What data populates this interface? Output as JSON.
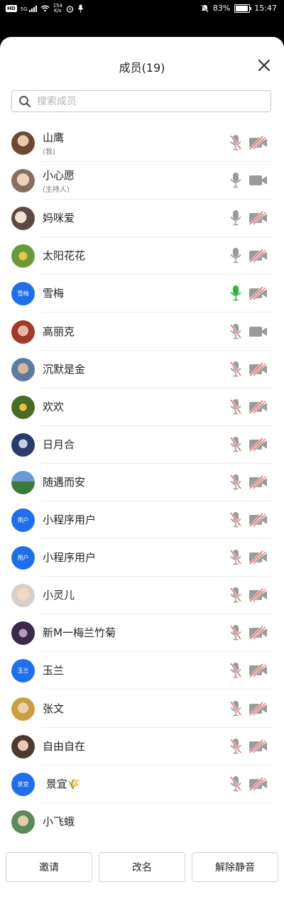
{
  "status_bar": {
    "network_chip": "HD",
    "signal_label": "5G",
    "speed_value": "154",
    "speed_unit": "K/s",
    "battery_level": "83%",
    "time": "15:47"
  },
  "header": {
    "title": "成员(19)"
  },
  "search": {
    "placeholder": "搜索成员"
  },
  "colors": {
    "accent": "#1e6fe9",
    "muted_icon": "#9a9a9a",
    "mic_active": "#2fb34a",
    "mute_slash": "#e05a5a"
  },
  "members": [
    {
      "name": "山鹰",
      "tag": "(我)",
      "avatar": "photo",
      "mic": "off",
      "cam": "off"
    },
    {
      "name": "小心愿",
      "tag": "(主持人)",
      "avatar": "photo",
      "mic": "on",
      "cam": "on"
    },
    {
      "name": "妈咪爱",
      "avatar": "photo",
      "mic": "on",
      "cam": "off"
    },
    {
      "name": "太阳花花",
      "avatar": "photo",
      "mic": "on",
      "cam": "off"
    },
    {
      "name": "雪梅",
      "avatar": "text",
      "avatar_text": "雪梅",
      "mic": "active",
      "cam": "off"
    },
    {
      "name": "高丽克",
      "avatar": "photo",
      "mic": "off",
      "cam": "on"
    },
    {
      "name": "沉默是金",
      "avatar": "photo",
      "mic": "off",
      "cam": "off"
    },
    {
      "name": "欢欢",
      "avatar": "photo",
      "mic": "off",
      "cam": "off"
    },
    {
      "name": "日月合",
      "avatar": "photo",
      "mic": "off",
      "cam": "off"
    },
    {
      "name": "随遇而安",
      "avatar": "photo",
      "mic": "off",
      "cam": "off"
    },
    {
      "name": "小程序用户",
      "avatar": "text",
      "avatar_text": "用户",
      "mic": "off",
      "cam": "off"
    },
    {
      "name": "小程序用户",
      "avatar": "text",
      "avatar_text": "用户",
      "mic": "off",
      "cam": "off"
    },
    {
      "name": "小灵儿",
      "avatar": "photo",
      "mic": "off",
      "cam": "off"
    },
    {
      "name": "新M一梅兰竹菊",
      "avatar": "photo",
      "mic": "off",
      "cam": "off"
    },
    {
      "name": "玉兰",
      "avatar": "text",
      "avatar_text": "玉兰",
      "mic": "off",
      "cam": "off"
    },
    {
      "name": "张文",
      "avatar": "photo",
      "mic": "off",
      "cam": "off"
    },
    {
      "name": "自由自在",
      "avatar": "photo",
      "mic": "off",
      "cam": "off"
    },
    {
      "name": " 景宜🌾",
      "avatar": "text",
      "avatar_text": "景宜",
      "mic": "off",
      "cam": "off"
    },
    {
      "name": "小飞蛾",
      "avatar": "photo",
      "mic": "none",
      "cam": "none"
    }
  ],
  "footer": {
    "invite": "邀请",
    "rename": "改名",
    "unmute_all": "解除静音"
  }
}
